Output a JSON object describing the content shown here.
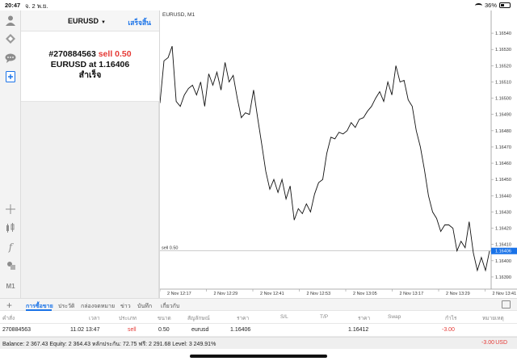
{
  "status": {
    "time": "20:47",
    "date": "จ. 2 พ.ย.",
    "battery": "36%"
  },
  "order_panel": {
    "symbol": "EURUSD",
    "done_label": "เสร็จสิ้น",
    "ticket": "#270884563",
    "side": "sell 0.50",
    "line2_prefix": "EURUSD at",
    "price": "1.16406",
    "result": "สำเร็จ"
  },
  "rail": {
    "icons": [
      "profile-icon",
      "signals-icon",
      "chat-icon",
      "new-order-icon",
      "crosshair-icon",
      "indicators-icon",
      "function-icon",
      "objects-icon"
    ],
    "timeframe": "M1"
  },
  "chart_data": {
    "type": "line",
    "title": "EURUSD, M1",
    "series": [
      {
        "values": [
          1.16497,
          1.16523,
          1.16525,
          1.16532,
          1.16498,
          1.16495,
          1.16502,
          1.16506,
          1.16508,
          1.16502,
          1.1651,
          1.16495,
          1.16515,
          1.16508,
          1.16516,
          1.16505,
          1.16522,
          1.1651,
          1.16514,
          1.165,
          1.16488,
          1.16491,
          1.1649,
          1.16505,
          1.16488,
          1.16472,
          1.16455,
          1.16444,
          1.1645,
          1.16442,
          1.1645,
          1.16438,
          1.16446,
          1.16425,
          1.16432,
          1.16429,
          1.16435,
          1.1643,
          1.16441,
          1.16448,
          1.1645,
          1.16466,
          1.16476,
          1.16475,
          1.16479,
          1.16478,
          1.1648,
          1.16485,
          1.16482,
          1.16487,
          1.16488,
          1.16492,
          1.16495,
          1.165,
          1.16504,
          1.16498,
          1.1651,
          1.16502,
          1.1652,
          1.1651,
          1.16511,
          1.16499,
          1.16495,
          1.1648,
          1.1647,
          1.16456,
          1.1644,
          1.1643,
          1.16426,
          1.16418,
          1.16422,
          1.16422,
          1.1642,
          1.16406,
          1.16412,
          1.16408,
          1.16424,
          1.16405,
          1.16394,
          1.16402,
          1.16394,
          1.16406
        ]
      }
    ],
    "x_ticks": [
      "2 Nov 12:17",
      "2 Nov 12:29",
      "2 Nov 12:41",
      "2 Nov 12:53",
      "2 Nov 13:05",
      "2 Nov 13:17",
      "2 Nov 13:29",
      "2 Nov 13:41"
    ],
    "y_ticks": [
      "1.16540",
      "1.16530",
      "1.16520",
      "1.16510",
      "1.16500",
      "1.16490",
      "1.16480",
      "1.16470",
      "1.16460",
      "1.16450",
      "1.16440",
      "1.16430",
      "1.16420",
      "1.16410",
      "1.16400",
      "1.16390"
    ],
    "ylim": [
      1.16385,
      1.16548
    ],
    "order_line": {
      "label": "sell 0.50",
      "price": 1.16406,
      "price_label": "1.16406"
    },
    "grid": false
  },
  "tabs": {
    "items": [
      "การซื้อขาย",
      "ประวัติ",
      "กล่องจดหมาย",
      "ข่าว",
      "บันทึก",
      "เกี่ยวกับ"
    ],
    "active": 0
  },
  "table": {
    "headers": [
      "คำสั่ง",
      "เวลา",
      "ประเภท",
      "ขนาด",
      "สัญลักษณ์",
      "ราคา",
      "S/L",
      "T/P",
      "ราคา",
      "Swap",
      "กำไร",
      "หมายเหตุ"
    ],
    "row": {
      "order": "270884563",
      "time": "11.02 13:47",
      "type": "sell",
      "size": "0.50",
      "symbol": "eurusd",
      "price": "1.16406",
      "current_price": "1.16412",
      "profit": "-3.00"
    }
  },
  "balance": {
    "text": "Balance: 2 367.43 Equity: 2 364.43 หลักประกัน: 72.75 ฟรี: 2 291.68 Level: 3 249.91%",
    "total": "-3.00",
    "currency": "USD"
  },
  "colors": {
    "accent": "#1a73e8",
    "sell": "#e53935",
    "price_tag": "#1a73e8"
  }
}
